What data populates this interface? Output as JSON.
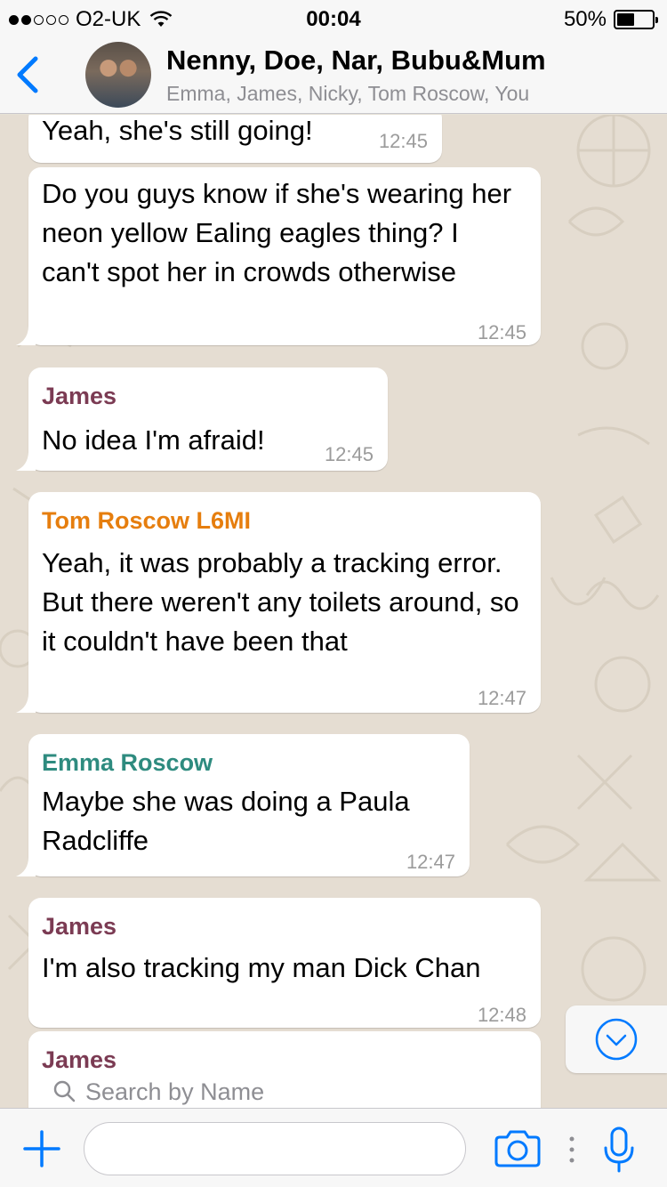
{
  "status_bar": {
    "carrier": "O2-UK",
    "time": "00:04",
    "battery_percent": "50%",
    "battery_level": 0.5
  },
  "header": {
    "title": "Nenny, Doe, Nar, Bubu&Mum",
    "subtitle": "Emma, James, Nicky, Tom Roscow, You"
  },
  "colors": {
    "accent": "#007aff",
    "sender_james": "#7b3b53",
    "sender_tom": "#e67e0e",
    "sender_emma": "#2e8b7f"
  },
  "messages": [
    {
      "sender": "",
      "text": "Yeah, she's still going!",
      "time": "12:45"
    },
    {
      "sender": "",
      "text": "Do you guys know if she's wearing her neon yellow Ealing eagles thing? I can't spot her in crowds otherwise",
      "time": "12:45"
    },
    {
      "sender": "James",
      "text": "No idea I'm afraid!",
      "time": "12:45"
    },
    {
      "sender": "Tom Roscow L6MI",
      "text": "Yeah, it was probably a tracking error. But there weren't any toilets around, so it couldn't have been that",
      "time": "12:47"
    },
    {
      "sender": "Emma Roscow",
      "text": "Maybe she was doing a Paula Radcliffe",
      "time": "12:47"
    },
    {
      "sender": "James",
      "text": "I'm also tracking my man Dick Chan",
      "time": "12:48"
    },
    {
      "sender": "James",
      "text": "",
      "time": ""
    }
  ],
  "shared_content": {
    "search_placeholder": "Search by Name"
  },
  "input_bar": {
    "value": "",
    "icons": [
      "plus-icon",
      "camera-icon",
      "more-dots-icon",
      "microphone-icon"
    ]
  }
}
